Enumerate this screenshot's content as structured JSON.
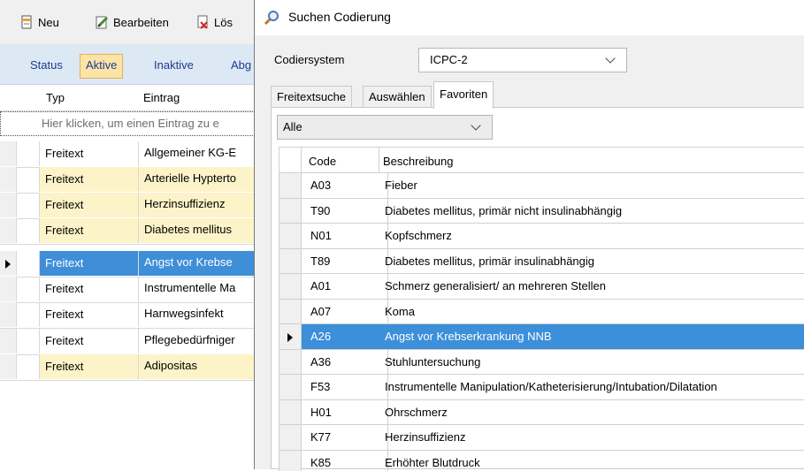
{
  "background_window": {
    "toolbar": [
      {
        "label": "Neu",
        "icon": "new-document-icon"
      },
      {
        "label": "Bearbeiten",
        "icon": "edit-pencil-icon"
      },
      {
        "label": "Lös",
        "icon": "delete-icon"
      }
    ],
    "status_bar": {
      "status_label": "Status",
      "aktive_label": "Aktive",
      "inaktive_label": "Inaktive",
      "abg_label": "Abg"
    },
    "grid": {
      "columns": [
        "Typ",
        "Eintrag"
      ],
      "new_row_hint": "Hier klicken, um einen Eintrag zu e",
      "rows": [
        {
          "typ": "Freitext",
          "eintrag": "Allgemeiner KG-E"
        },
        {
          "typ": "Freitext",
          "eintrag": "Arterielle Hypterto"
        },
        {
          "typ": "Freitext",
          "eintrag": "Herzinsuffizienz"
        },
        {
          "typ": "Freitext",
          "eintrag": "Diabetes mellitus"
        },
        {
          "typ": "Freitext",
          "eintrag": "Angst vor Krebse"
        },
        {
          "typ": "Freitext",
          "eintrag": "Instrumentelle Ma"
        },
        {
          "typ": "Freitext",
          "eintrag": "Harnwegsinfekt"
        },
        {
          "typ": "Freitext",
          "eintrag": "Pflegebedürfniger"
        },
        {
          "typ": "Freitext",
          "eintrag": "Adipositas"
        }
      ]
    }
  },
  "dialog": {
    "title": "Suchen Codierung",
    "title_icon": "magnifier-icon",
    "codiersystem_label": "Codiersystem",
    "codiersystem_value": "ICPC-2",
    "tabs": [
      "Freitextsuche",
      "Auswählen",
      "Favoriten"
    ],
    "active_tab": "Favoriten",
    "filter_value": "Alle",
    "favorites_grid": {
      "columns": [
        "Code",
        "Beschreibung"
      ],
      "rows": [
        {
          "code": "A03",
          "desc": "Fieber"
        },
        {
          "code": "T90",
          "desc": "Diabetes mellitus, primär nicht insulinabhängig"
        },
        {
          "code": "N01",
          "desc": "Kopfschmerz"
        },
        {
          "code": "T89",
          "desc": "Diabetes mellitus, primär insulinabhängig"
        },
        {
          "code": "A01",
          "desc": "Schmerz generalisiert/ an mehreren Stellen"
        },
        {
          "code": "A07",
          "desc": "Koma"
        },
        {
          "code": "A26",
          "desc": "Angst vor Krebserkrankung NNB"
        },
        {
          "code": "A36",
          "desc": "Stuhluntersuchung"
        },
        {
          "code": "F53",
          "desc": "Instrumentelle Manipulation/Katheterisierung/Intubation/Dilatation"
        },
        {
          "code": "H01",
          "desc": "Ohrschmerz"
        },
        {
          "code": "K77",
          "desc": "Herzinsuffizienz"
        },
        {
          "code": "K85",
          "desc": "Erhöhter Blutdruck"
        }
      ]
    }
  },
  "colors": {
    "selection": "#3c8fd9",
    "highlight_row": "#fcf4c8",
    "active_status": "#fce4a8",
    "status_bar": "#dde8f5"
  }
}
